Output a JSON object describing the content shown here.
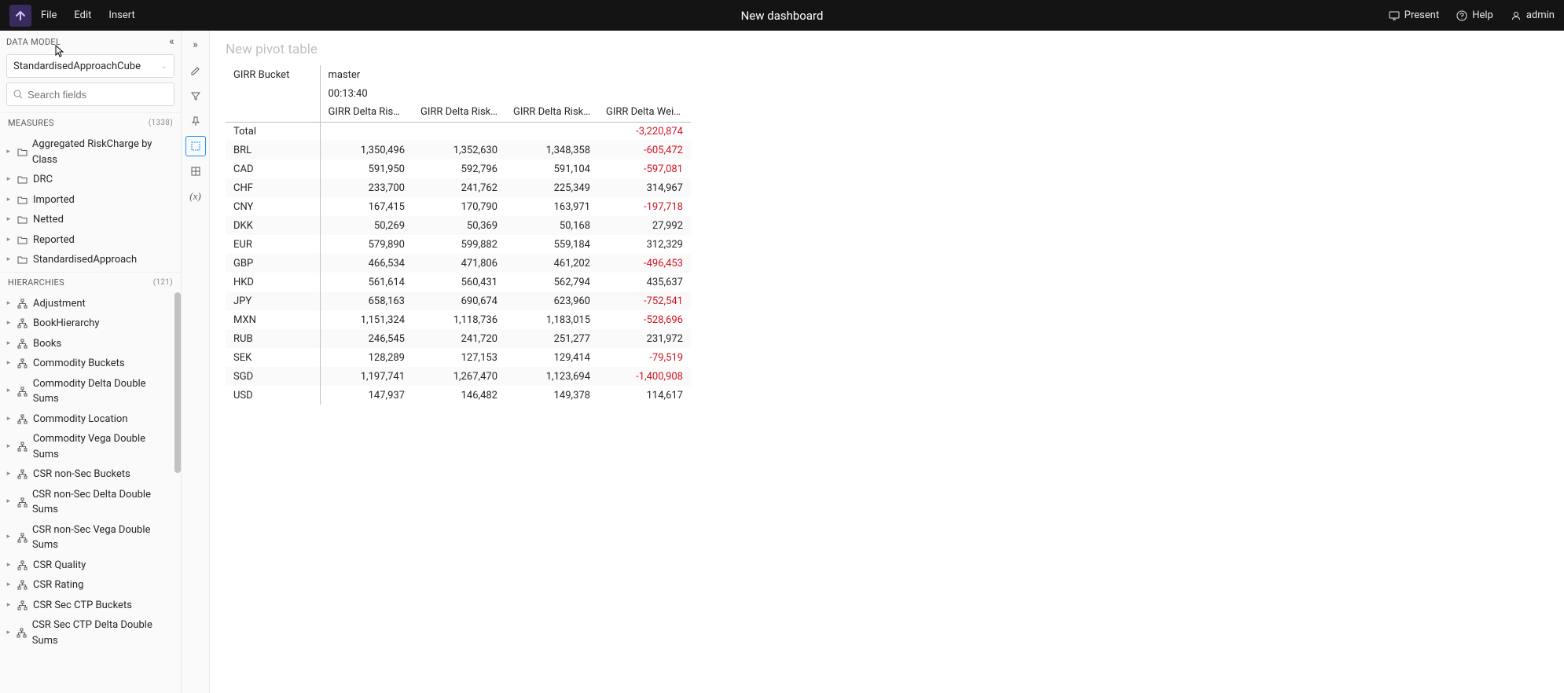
{
  "topbar": {
    "menu": {
      "file": "File",
      "edit": "Edit",
      "insert": "Insert"
    },
    "title": "New dashboard",
    "right": {
      "present": "Present",
      "help": "Help",
      "user": "admin"
    }
  },
  "sidebar": {
    "data_model_label": "DATA MODEL",
    "cube": "StandardisedApproachCube",
    "search_placeholder": "Search fields",
    "measures": {
      "label": "MEASURES",
      "count": "(1338)",
      "items": [
        "Aggregated RiskCharge by Class",
        "DRC",
        "Imported",
        "Netted",
        "Reported",
        "StandardisedApproach"
      ]
    },
    "hierarchies": {
      "label": "HIERARCHIES",
      "count": "(121)",
      "items": [
        "Adjustment",
        "BookHierarchy",
        "Books",
        "Commodity Buckets",
        "Commodity Delta Double Sums",
        "Commodity Location",
        "Commodity Vega Double Sums",
        "CSR non-Sec Buckets",
        "CSR non-Sec Delta Double Sums",
        "CSR non-Sec Vega Double Sums",
        "CSR Quality",
        "CSR Rating",
        "CSR Sec CTP Buckets",
        "CSR Sec CTP Delta Double Sums"
      ]
    }
  },
  "pivot": {
    "title": "New pivot table",
    "row_dim": "GIRR Bucket",
    "col_top": "master",
    "col_time": "00:13:40",
    "columns": [
      "GIRR Delta Risk P...",
      "GIRR Delta Risk P...",
      "GIRR Delta Risk P...",
      "GIRR Delta Weigh..."
    ],
    "rows": [
      {
        "label": "Total",
        "values": [
          "",
          "",
          "",
          "-3,220,874"
        ],
        "neg": [
          false,
          false,
          false,
          true
        ]
      },
      {
        "label": "BRL",
        "values": [
          "1,350,496",
          "1,352,630",
          "1,348,358",
          "-605,472"
        ],
        "neg": [
          false,
          false,
          false,
          true
        ]
      },
      {
        "label": "CAD",
        "values": [
          "591,950",
          "592,796",
          "591,104",
          "-597,081"
        ],
        "neg": [
          false,
          false,
          false,
          true
        ]
      },
      {
        "label": "CHF",
        "values": [
          "233,700",
          "241,762",
          "225,349",
          "314,967"
        ],
        "neg": [
          false,
          false,
          false,
          false
        ]
      },
      {
        "label": "CNY",
        "values": [
          "167,415",
          "170,790",
          "163,971",
          "-197,718"
        ],
        "neg": [
          false,
          false,
          false,
          true
        ]
      },
      {
        "label": "DKK",
        "values": [
          "50,269",
          "50,369",
          "50,168",
          "27,992"
        ],
        "neg": [
          false,
          false,
          false,
          false
        ]
      },
      {
        "label": "EUR",
        "values": [
          "579,890",
          "599,882",
          "559,184",
          "312,329"
        ],
        "neg": [
          false,
          false,
          false,
          false
        ]
      },
      {
        "label": "GBP",
        "values": [
          "466,534",
          "471,806",
          "461,202",
          "-496,453"
        ],
        "neg": [
          false,
          false,
          false,
          true
        ]
      },
      {
        "label": "HKD",
        "values": [
          "561,614",
          "560,431",
          "562,794",
          "435,637"
        ],
        "neg": [
          false,
          false,
          false,
          false
        ]
      },
      {
        "label": "JPY",
        "values": [
          "658,163",
          "690,674",
          "623,960",
          "-752,541"
        ],
        "neg": [
          false,
          false,
          false,
          true
        ]
      },
      {
        "label": "MXN",
        "values": [
          "1,151,324",
          "1,118,736",
          "1,183,015",
          "-528,696"
        ],
        "neg": [
          false,
          false,
          false,
          true
        ]
      },
      {
        "label": "RUB",
        "values": [
          "246,545",
          "241,720",
          "251,277",
          "231,972"
        ],
        "neg": [
          false,
          false,
          false,
          false
        ]
      },
      {
        "label": "SEK",
        "values": [
          "128,289",
          "127,153",
          "129,414",
          "-79,519"
        ],
        "neg": [
          false,
          false,
          false,
          true
        ]
      },
      {
        "label": "SGD",
        "values": [
          "1,197,741",
          "1,267,470",
          "1,123,694",
          "-1,400,908"
        ],
        "neg": [
          false,
          false,
          false,
          true
        ]
      },
      {
        "label": "USD",
        "values": [
          "147,937",
          "146,482",
          "149,378",
          "114,617"
        ],
        "neg": [
          false,
          false,
          false,
          false
        ]
      }
    ]
  }
}
